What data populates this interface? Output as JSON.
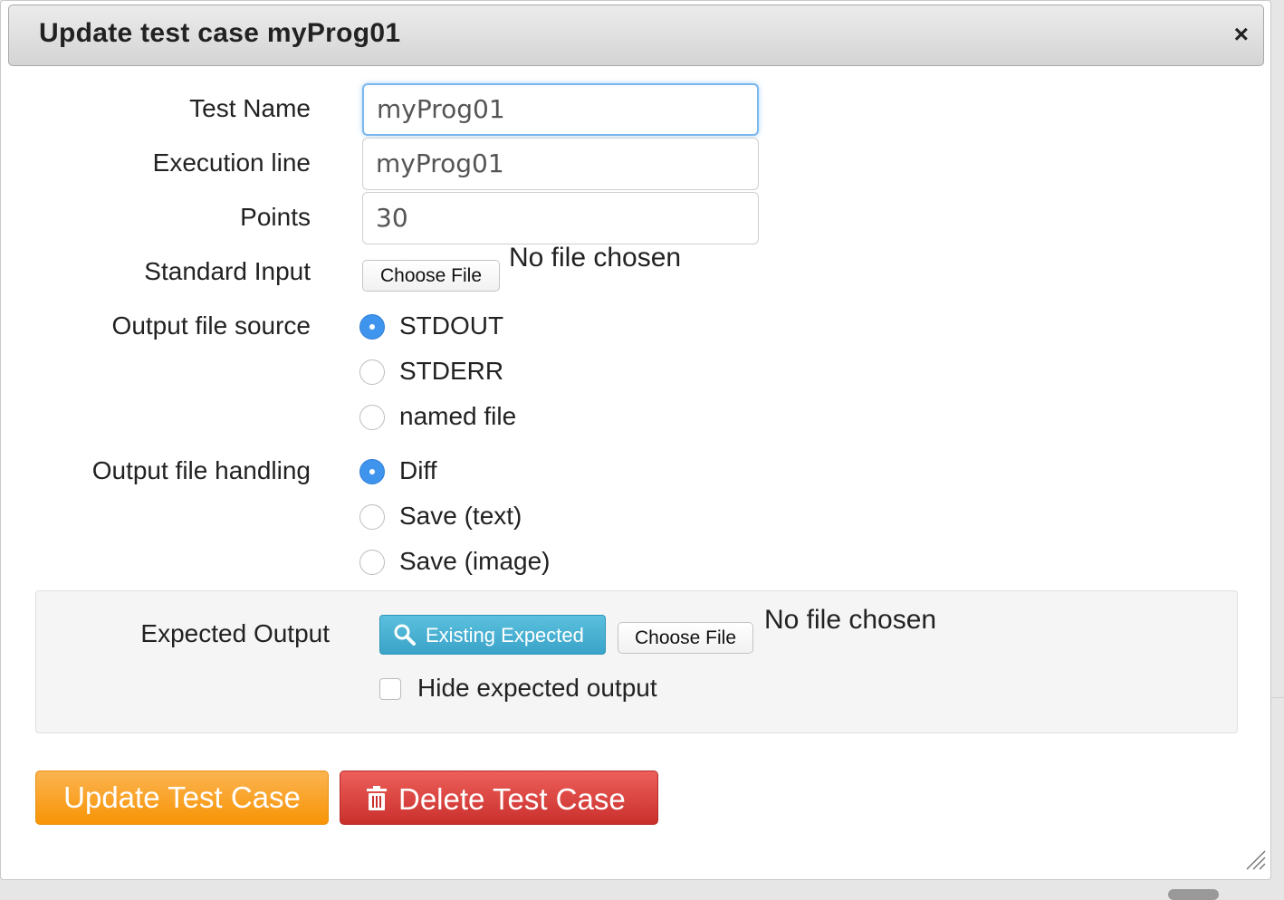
{
  "dialog": {
    "title": "Update test case myProg01",
    "close_glyph": "×"
  },
  "form": {
    "test_name": {
      "label": "Test Name",
      "value": "myProg01"
    },
    "execution_line": {
      "label": "Execution line",
      "value": "myProg01"
    },
    "points": {
      "label": "Points",
      "value": "30"
    },
    "standard_input": {
      "label": "Standard Input",
      "button": "Choose File",
      "status": "No file chosen"
    },
    "output_file_source": {
      "label": "Output file source",
      "options": [
        "STDOUT",
        "STDERR",
        "named file"
      ],
      "selected": "STDOUT"
    },
    "output_file_handling": {
      "label": "Output file handling",
      "options": [
        "Diff",
        "Save (text)",
        "Save (image)"
      ],
      "selected": "Diff"
    },
    "expected_output": {
      "label": "Expected Output",
      "existing_button": "Existing Expected",
      "file_button": "Choose File",
      "status": "No file chosen",
      "hide_checkbox_label": "Hide expected output",
      "hide_checked": false
    }
  },
  "actions": {
    "update": "Update Test Case",
    "delete": "Delete Test Case"
  },
  "colors": {
    "update_button": "#f89406",
    "delete_button": "#c9302c",
    "info_button": "#5bc0de",
    "radio_checked": "#3f95ee",
    "focus_border": "#7ab6ef"
  },
  "icons": {
    "close": "close-icon",
    "search": "search-icon",
    "trash": "trash-icon",
    "resize": "resize-grip-icon"
  }
}
